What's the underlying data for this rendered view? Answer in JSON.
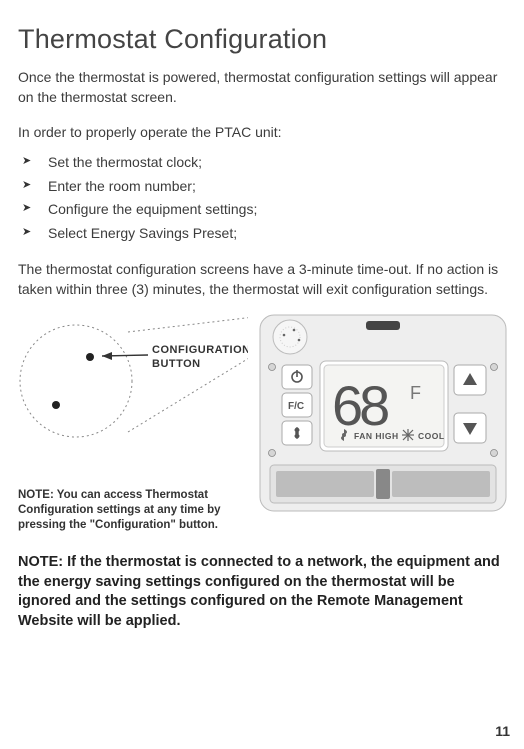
{
  "title": "Thermostat Conﬁguration",
  "intro": "Once the thermostat is powered, thermostat conﬁguration settings will appear on the thermostat screen.",
  "sub": "In order to properly operate the PTAC unit:",
  "steps": [
    "Set the thermostat clock;",
    "Enter the room number;",
    "Conﬁgure the equipment settings;",
    "Select Energy Savings Preset;"
  ],
  "timeout": "The thermostat conﬁguration screens have a 3-minute time-out. If no action is taken within three (3) minutes, the thermostat will exit conﬁguration settings.",
  "config_button_label_line1": "CONFIGURATION",
  "config_button_label_line2": "BUTTON",
  "note_small": "NOTE: You can access Thermostat Conﬁguration settings at any time by pressing the \"Conﬁguration\" button.",
  "note_bold": "NOTE: If the thermostat is connected to a network, the equipment and the energy saving settings conﬁgured on the thermostat will be ignored and the settings conﬁgured on the Remote Management Website will be applied.",
  "thermostat": {
    "temperature": "68",
    "unit": "F",
    "fan_setting": "FAN HIGH",
    "mode": "COOL"
  },
  "page_number": "11"
}
